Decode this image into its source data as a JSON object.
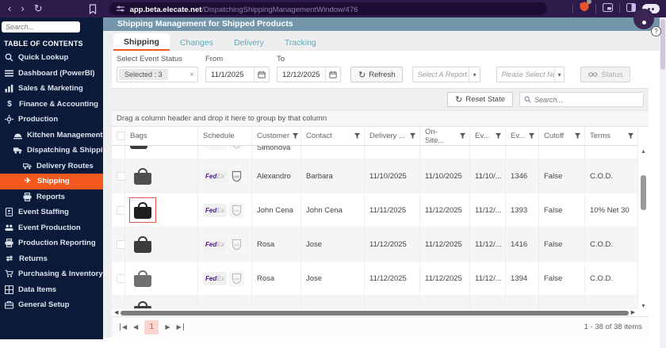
{
  "icons": {
    "back": "‹",
    "forward": "›",
    "reload": "↻",
    "refresh": "↻",
    "caret": "▾",
    "close": "×",
    "up": "▲",
    "down": "▼",
    "left": "◀",
    "right": "▶",
    "help": "?",
    "returns_glyph": "⇄",
    "plane_glyph": "✈",
    "finance_glyph": "$"
  },
  "colors": {
    "accent_orange": "#f4581c",
    "sidebar_bg": "#0a1a38",
    "chrome_bg": "#2f1a4c",
    "titlebar_bg": "#7496aa",
    "tab_inactive_text": "#58aabe",
    "highlight_red": "#e2574b",
    "fedex_purple": "#4d148c",
    "pagination_active_bg": "#fbd6d1",
    "pagination_active_text": "#dd5144"
  },
  "chrome": {
    "url_host": "app.beta.elecate.net",
    "url_path": "/DispatchingShippingManagementWindow/476"
  },
  "sidebar": {
    "search_placeholder": "Search...",
    "title": "TABLE OF CONTENTS",
    "items": [
      {
        "label": "Quick Lookup"
      },
      {
        "label": "Dashboard (PowerBI)"
      },
      {
        "label": "Sales & Marketing"
      },
      {
        "label": "Finance & Accounting"
      },
      {
        "label": "Production"
      },
      {
        "label": "Kitchen Management"
      },
      {
        "label": "Dispatching & Shipping"
      },
      {
        "label": "Delivery Routes"
      },
      {
        "label": "Shipping"
      },
      {
        "label": "Reports"
      },
      {
        "label": "Event Staffing"
      },
      {
        "label": "Event Production"
      },
      {
        "label": "Production Reporting"
      },
      {
        "label": "Returns"
      },
      {
        "label": "Purchasing & Inventory"
      },
      {
        "label": "Data Items"
      },
      {
        "label": "General Setup"
      }
    ]
  },
  "window": {
    "title": "Shipping Management for Shipped Products"
  },
  "tabs": [
    "Shipping",
    "Changes",
    "Delivery",
    "Tracking"
  ],
  "filters": {
    "status_label": "Select Event Status",
    "status_value": "Selected : 3",
    "from_label": "From",
    "from_value": "11/1/2025",
    "to_label": "To",
    "to_value": "12/12/2025",
    "refresh_label": "Refresh",
    "report_placeholder": "Select A Report...",
    "new_placeholder": "Please Select New ...",
    "status_button": "Status"
  },
  "toolbar": {
    "reset_label": "Reset State",
    "search_placeholder": "Search..."
  },
  "group_bar": {
    "text": "Drag a column header and drop it here to group by that column"
  },
  "table": {
    "columns": [
      "Bags",
      "Schedule",
      "Customer",
      "Contact",
      "Delivery ...",
      "On-Site...",
      "Ev...",
      "Ev...",
      "Cutoff",
      "Terms"
    ],
    "carrier_fedex_a": "Fed",
    "carrier_fedex_b": "Ex",
    "carrier_ups": "ups",
    "partial_row_customer": "Simonova",
    "rows": [
      {
        "customer": "Alexandro",
        "contact": "Barbara",
        "delivery": "11/10/2025",
        "onsite": "11/10/2025",
        "event_date": "11/10/...",
        "event_id": "1346",
        "cutoff": "False",
        "terms": "C.O.D."
      },
      {
        "customer": "John Cena",
        "contact": "John Cena",
        "delivery": "11/11/2025",
        "onsite": "11/12/2025",
        "event_date": "11/12/...",
        "event_id": "1393",
        "cutoff": "False",
        "terms": "10% Net 30"
      },
      {
        "customer": "Rosa",
        "contact": "Jose",
        "delivery": "11/12/2025",
        "onsite": "11/12/2025",
        "event_date": "11/12/...",
        "event_id": "1416",
        "cutoff": "False",
        "terms": "C.O.D."
      },
      {
        "customer": "Rosa",
        "contact": "Jose",
        "delivery": "11/12/2025",
        "onsite": "11/12/2025",
        "event_date": "11/12/...",
        "event_id": "1394",
        "cutoff": "False",
        "terms": "C.O.D."
      }
    ]
  },
  "pagination": {
    "page": "1",
    "summary": "1 - 38 of 38 items"
  }
}
